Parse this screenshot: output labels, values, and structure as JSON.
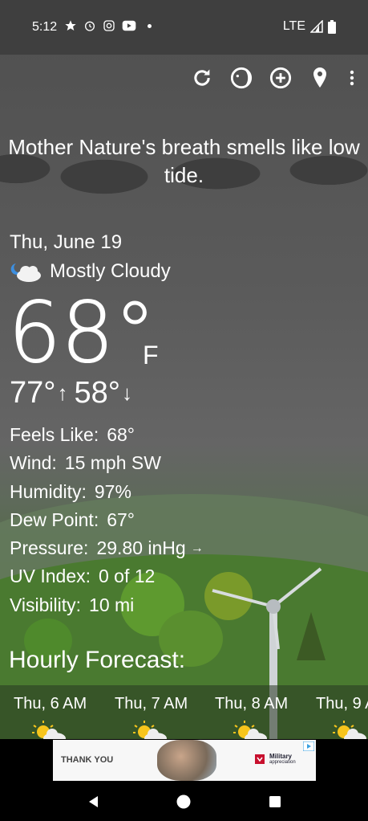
{
  "status_bar": {
    "time": "5:12",
    "network": "LTE",
    "icons": [
      "star-icon",
      "alarm-icon",
      "instagram-icon",
      "youtube-icon",
      "dot-icon"
    ]
  },
  "toolbar": {
    "icons": [
      "refresh-icon",
      "moon-phase-icon",
      "add-location-icon",
      "location-pin-icon",
      "overflow-menu-icon"
    ]
  },
  "quote": "Mother Nature's breath smells like low tide.",
  "current": {
    "date": "Thu, June 19",
    "condition": "Mostly Cloudy",
    "condition_icon": "mostly-cloudy-night-icon",
    "temp": "68°",
    "unit": "F",
    "high": "77°",
    "low": "58°"
  },
  "details": [
    {
      "label": "Feels Like:",
      "value": "68°"
    },
    {
      "label": "Wind:",
      "value": "15 mph SW"
    },
    {
      "label": "Humidity:",
      "value": "97%"
    },
    {
      "label": "Dew Point:",
      "value": "67°"
    },
    {
      "label": "Pressure:",
      "value": "29.80 inHg",
      "trend": "→"
    },
    {
      "label": "UV Index:",
      "value": "0 of 12"
    },
    {
      "label": "Visibility:",
      "value": "10 mi"
    }
  ],
  "hourly": {
    "title": "Hourly Forecast:",
    "items": [
      {
        "label": "Thu, 6 AM",
        "icon": "partly-sunny-icon"
      },
      {
        "label": "Thu, 7 AM",
        "icon": "partly-sunny-icon"
      },
      {
        "label": "Thu, 8 AM",
        "icon": "partly-sunny-icon"
      },
      {
        "label": "Thu, 9 A",
        "icon": "partly-sunny-icon"
      }
    ]
  },
  "ad": {
    "left_text": "THANK YOU",
    "brand": "Military",
    "brand_sub": "appreciation"
  },
  "colors": {
    "sky": "#5b5b5b",
    "status_bar": "#3f3f3f",
    "grass": "#4a7a30"
  }
}
